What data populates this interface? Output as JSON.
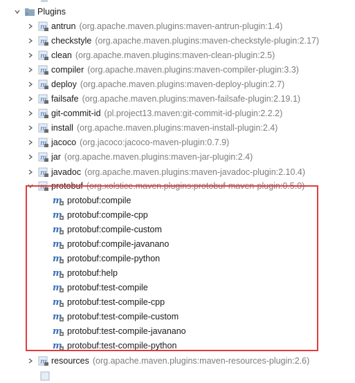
{
  "tree": {
    "root": {
      "label": "Plugins"
    },
    "plugins": [
      {
        "name": "antrun",
        "coord": "(org.apache.maven.plugins:maven-antrun-plugin:1.4)"
      },
      {
        "name": "checkstyle",
        "coord": "(org.apache.maven.plugins:maven-checkstyle-plugin:2.17)"
      },
      {
        "name": "clean",
        "coord": "(org.apache.maven.plugins:maven-clean-plugin:2.5)"
      },
      {
        "name": "compiler",
        "coord": "(org.apache.maven.plugins:maven-compiler-plugin:3.3)"
      },
      {
        "name": "deploy",
        "coord": "(org.apache.maven.plugins:maven-deploy-plugin:2.7)"
      },
      {
        "name": "failsafe",
        "coord": "(org.apache.maven.plugins:maven-failsafe-plugin:2.19.1)"
      },
      {
        "name": "git-commit-id",
        "coord": "(pl.project13.maven:git-commit-id-plugin:2.2.2)"
      },
      {
        "name": "install",
        "coord": "(org.apache.maven.plugins:maven-install-plugin:2.4)"
      },
      {
        "name": "jacoco",
        "coord": "(org.jacoco:jacoco-maven-plugin:0.7.9)"
      },
      {
        "name": "jar",
        "coord": "(org.apache.maven.plugins:maven-jar-plugin:2.4)"
      },
      {
        "name": "javadoc",
        "coord": "(org.apache.maven.plugins:maven-javadoc-plugin:2.10.4)"
      }
    ],
    "protobuf": {
      "name": "protobuf",
      "coord": "(org.xolstice.maven.plugins:protobuf-maven-plugin:0.5.0)",
      "goals": [
        "protobuf:compile",
        "protobuf:compile-cpp",
        "protobuf:compile-custom",
        "protobuf:compile-javanano",
        "protobuf:compile-python",
        "protobuf:help",
        "protobuf:test-compile",
        "protobuf:test-compile-cpp",
        "protobuf:test-compile-custom",
        "protobuf:test-compile-javanano",
        "protobuf:test-compile-python"
      ]
    },
    "after": [
      {
        "name": "resources",
        "coord": "(org.apache.maven.plugins:maven-resources-plugin:2.6)"
      }
    ]
  },
  "colors": {
    "highlight_border": "#e23b3b",
    "coord_text": "#7d7d7d",
    "folder": "#8fa6bf",
    "maven_icon": "#3b6fb6"
  }
}
